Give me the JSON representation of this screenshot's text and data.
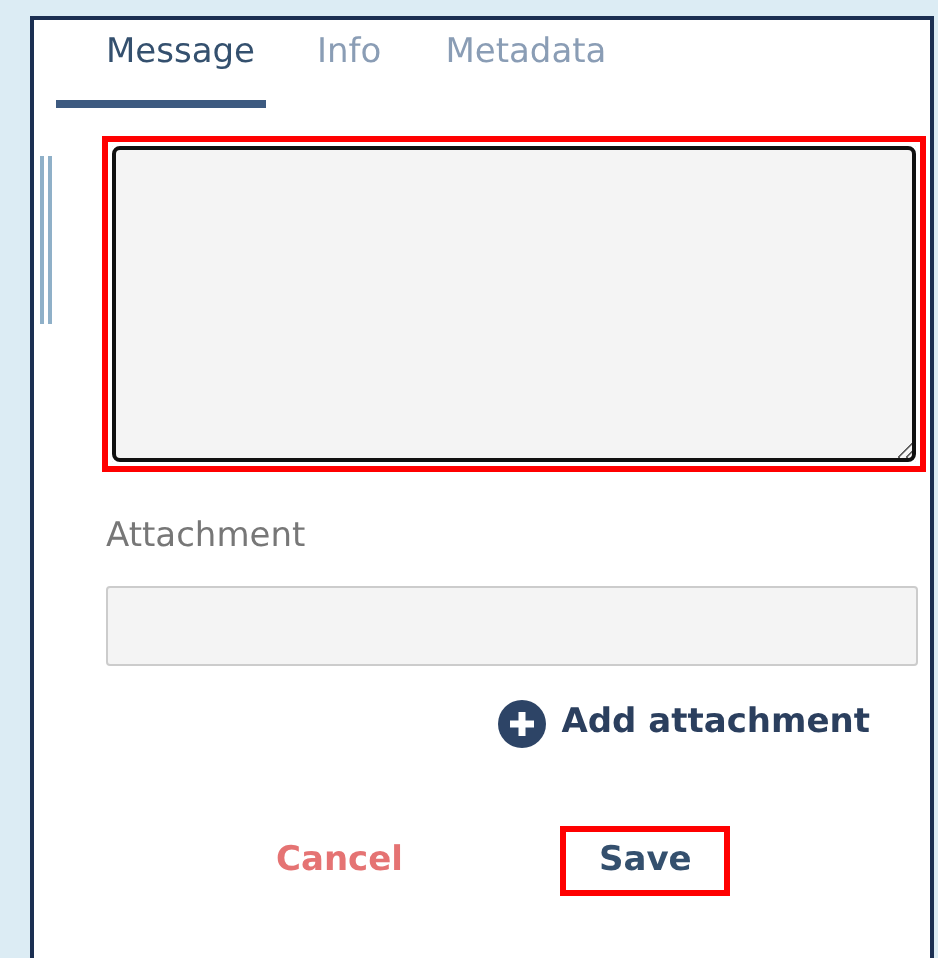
{
  "tabs": [
    {
      "label": "Message",
      "selected": true
    },
    {
      "label": "Info",
      "selected": false
    },
    {
      "label": "Metadata",
      "selected": false
    }
  ],
  "message": {
    "highlighted": true
  },
  "attachment": {
    "label": "Attachment"
  },
  "add_attachment": "Add attachment",
  "buttons": [
    {
      "label": "Cancel",
      "kind": "cancel",
      "highlighted": false
    },
    {
      "label": "Save",
      "kind": "save",
      "highlighted": true
    }
  ]
}
